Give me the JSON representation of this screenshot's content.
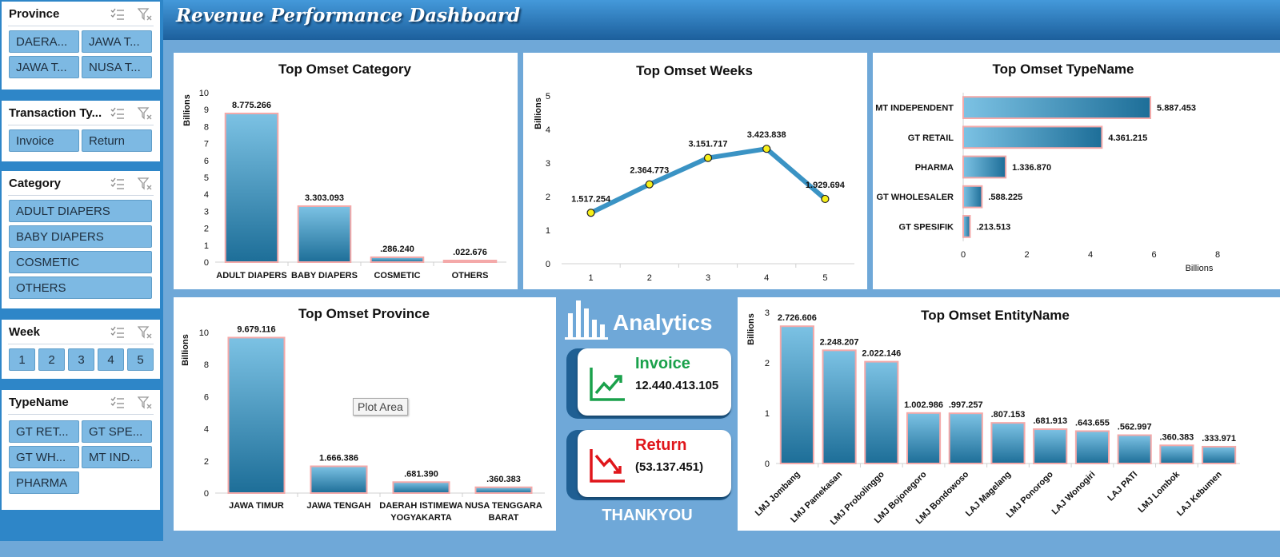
{
  "header": {
    "title": "Revenue Performance Dashboard"
  },
  "slicers": {
    "province": {
      "title": "Province",
      "items": [
        "DAERA...",
        "JAWA T...",
        "JAWA T...",
        "NUSA T..."
      ]
    },
    "transaction_type": {
      "title": "Transaction Ty...",
      "items": [
        "Invoice",
        "Return"
      ]
    },
    "category": {
      "title": "Category",
      "items": [
        "ADULT DIAPERS",
        "BABY DIAPERS",
        "COSMETIC",
        "OTHERS"
      ]
    },
    "week": {
      "title": "Week",
      "items": [
        "1",
        "2",
        "3",
        "4",
        "5"
      ]
    },
    "typename": {
      "title": "TypeName",
      "items": [
        "GT RET...",
        "GT SPE...",
        "GT WH...",
        "MT IND...",
        "PHARMA"
      ]
    }
  },
  "analytics": {
    "title": "Analytics",
    "invoice_label": "Invoice",
    "invoice_value": "12.440.413.105",
    "return_label": "Return",
    "return_value": "(53.137.451)",
    "footer": "THANKYOU"
  },
  "tooltip": {
    "text": "Plot Area"
  },
  "colors": {
    "bar": "#3a93c4",
    "bar_border": "#f4a9a9",
    "line": "#3a93c4",
    "marker": "#f7f01a",
    "invoice": "#1aa14b",
    "return": "#e0161b",
    "header": "#2a78bd"
  },
  "chart_data": [
    {
      "id": "category",
      "type": "bar",
      "title": "Top Omset Category",
      "ylabel": "Billions",
      "categories": [
        "ADULT DIAPERS",
        "BABY DIAPERS",
        "COSMETIC",
        "OTHERS"
      ],
      "values": [
        8.775266,
        3.303093,
        0.28624,
        0.022676
      ],
      "labels": [
        "8.775.266",
        "3.303.093",
        ".286.240",
        ".022.676"
      ],
      "ylim": [
        0,
        10
      ],
      "yticks": [
        "0",
        "1",
        "2",
        "3",
        "4",
        "5",
        "6",
        "7",
        "8",
        "9",
        "10"
      ]
    },
    {
      "id": "weeks",
      "type": "line",
      "title": "Top Omset Weeks",
      "ylabel": "Billions",
      "categories": [
        "1",
        "2",
        "3",
        "4",
        "5"
      ],
      "values": [
        1.517254,
        2.364773,
        3.151717,
        3.423838,
        1.929694
      ],
      "labels": [
        "1.517.254",
        "2.364.773",
        "3.151.717",
        "3.423.838",
        "1.929.694"
      ],
      "ylim": [
        0,
        5
      ],
      "yticks": [
        "0",
        "1",
        "2",
        "3",
        "4",
        "5"
      ]
    },
    {
      "id": "typename",
      "type": "bar",
      "orientation": "horizontal",
      "title": "Top Omset TypeName",
      "xlabel": "Billions",
      "categories": [
        "MT INDEPENDENT",
        "GT RETAIL",
        "PHARMA",
        "GT WHOLESALER",
        "GT SPESIFIK"
      ],
      "values": [
        5.887453,
        4.361215,
        1.33687,
        0.588225,
        0.213513
      ],
      "labels": [
        "5.887.453",
        "4.361.215",
        "1.336.870",
        ".588.225",
        ".213.513"
      ],
      "xlim": [
        0,
        8
      ],
      "xticks": [
        "0",
        "2",
        "4",
        "6",
        "8"
      ]
    },
    {
      "id": "province",
      "type": "bar",
      "title": "Top Omset Province",
      "ylabel": "Billions",
      "categories": [
        [
          "JAWA TIMUR"
        ],
        [
          "JAWA TENGAH"
        ],
        [
          "DAERAH ISTIMEWA",
          "YOGYAKARTA"
        ],
        [
          "NUSA TENGGARA",
          "BARAT"
        ]
      ],
      "values": [
        9.679116,
        1.666386,
        0.68139,
        0.360383
      ],
      "labels": [
        "9.679.116",
        "1.666.386",
        ".681.390",
        ".360.383"
      ],
      "ylim": [
        0,
        10
      ],
      "yticks": [
        "0",
        "2",
        "4",
        "6",
        "8",
        "10"
      ]
    },
    {
      "id": "entity",
      "type": "bar",
      "title": "Top Omset EntityName",
      "ylabel": "Billions",
      "categories": [
        "LMJ Jombang",
        "LMJ Pamekasan",
        "LMJ Probolinggo",
        "LMJ Bojonegoro",
        "LMJ Bondowoso",
        "LAJ Magelang",
        "LMJ Ponorogo",
        "LAJ Wonogiri",
        "LAJ PATI",
        "LMJ Lombok",
        "LAJ Kebumen"
      ],
      "values": [
        2.726606,
        2.248207,
        2.022146,
        1.002986,
        0.997257,
        0.807153,
        0.681913,
        0.643655,
        0.562997,
        0.360383,
        0.333971
      ],
      "labels": [
        "2.726.606",
        "2.248.207",
        "2.022.146",
        "1.002.986",
        ".997.257",
        ".807.153",
        ".681.913",
        ".643.655",
        ".562.997",
        ".360.383",
        ".333.971"
      ],
      "ylim": [
        0,
        3
      ],
      "yticks": [
        "0",
        "1",
        "2",
        "3"
      ]
    }
  ]
}
